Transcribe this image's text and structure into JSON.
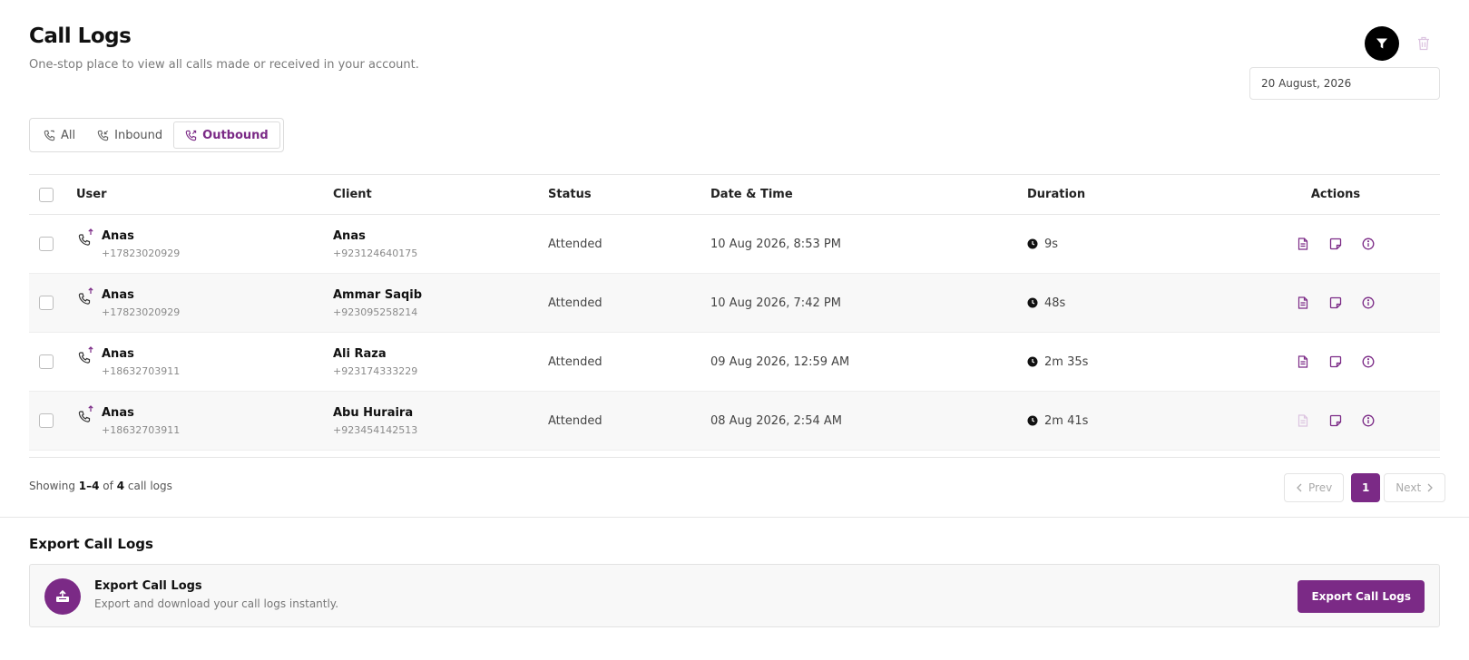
{
  "header": {
    "title": "Call Logs",
    "subtitle": "One-stop place to view all calls made or received in your account."
  },
  "toolbar": {
    "filter_icon": "filter-icon",
    "delete_icon": "trash-icon",
    "date_value": "20 August, 2026"
  },
  "tabs": [
    {
      "label": "All",
      "active": false
    },
    {
      "label": "Inbound",
      "active": false
    },
    {
      "label": "Outbound",
      "active": true
    }
  ],
  "table": {
    "columns": {
      "user": "User",
      "client": "Client",
      "status": "Status",
      "datetime": "Date & Time",
      "duration": "Duration",
      "actions": "Actions"
    },
    "rows": [
      {
        "user_name": "Anas",
        "user_phone": "+17823020929",
        "client_name": "Anas",
        "client_phone": "+923124640175",
        "status": "Attended",
        "datetime": "10 Aug 2026, 8:53 PM",
        "duration": "9s",
        "transcript_enabled": true
      },
      {
        "user_name": "Anas",
        "user_phone": "+17823020929",
        "client_name": "Ammar Saqib",
        "client_phone": "+923095258214",
        "status": "Attended",
        "datetime": "10 Aug 2026, 7:42 PM",
        "duration": "48s",
        "transcript_enabled": true
      },
      {
        "user_name": "Anas",
        "user_phone": "+18632703911",
        "client_name": "Ali Raza",
        "client_phone": "+923174333229",
        "status": "Attended",
        "datetime": "09 Aug 2026, 12:59 AM",
        "duration": "2m 35s",
        "transcript_enabled": true
      },
      {
        "user_name": "Anas",
        "user_phone": "+18632703911",
        "client_name": "Abu Huraira",
        "client_phone": "+923454142513",
        "status": "Attended",
        "datetime": "08 Aug 2026, 2:54 AM",
        "duration": "2m 41s",
        "transcript_enabled": false
      }
    ]
  },
  "pagination": {
    "showing_prefix": "Showing",
    "range": "1–4",
    "of": "of",
    "total": "4",
    "suffix": "call logs",
    "prev_label": "Prev",
    "current_page": "1",
    "next_label": "Next"
  },
  "export": {
    "heading": "Export Call Logs",
    "card_title": "Export Call Logs",
    "card_desc": "Export and download your call logs instantly.",
    "button_label": "Export Call Logs"
  },
  "colors": {
    "accent": "#7b2a86",
    "accent_light": "#dcc4e0"
  }
}
